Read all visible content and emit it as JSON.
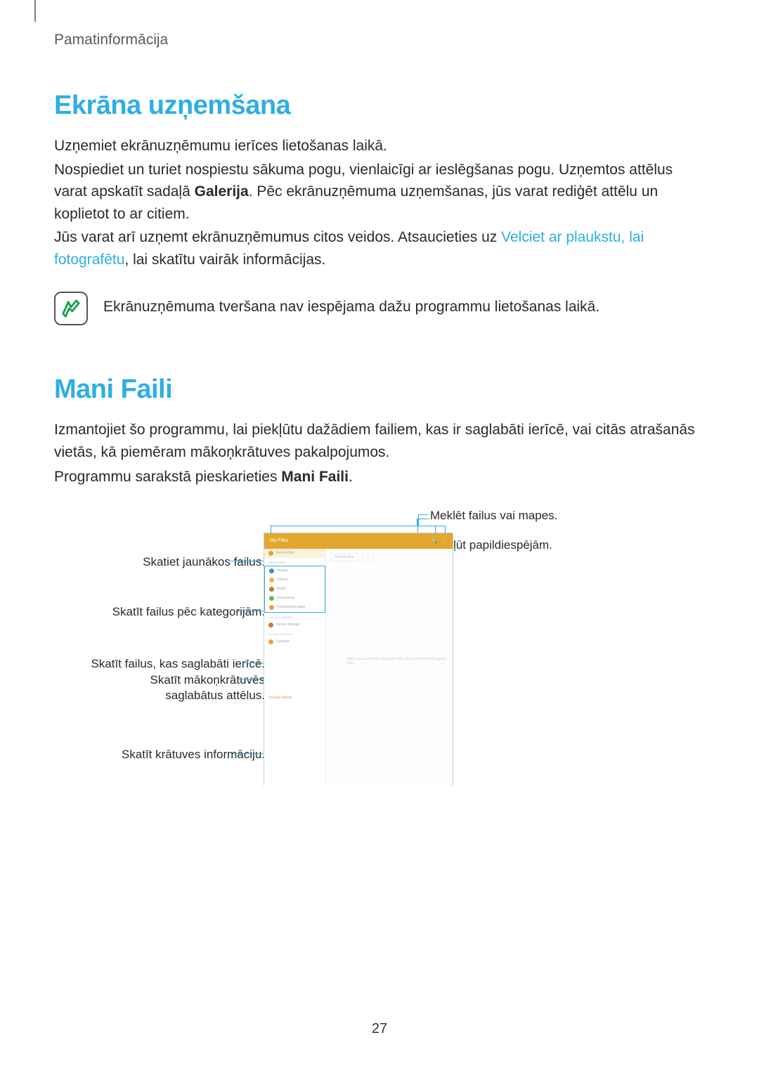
{
  "header": "Pamatinformācija",
  "section1": {
    "title": "Ekrāna uzņemšana",
    "p1": "Uzņemiet ekrānuzņēmumu ierīces lietošanas laikā.",
    "p2a": "Nospiediet un turiet nospiestu sākuma pogu, vienlaicīgi ar ieslēgšanas pogu. Uzņemtos attēlus varat apskatīt sadaļā ",
    "p2b_bold": "Galerija",
    "p2c": ". Pēc ekrānuzņēmuma uzņemšanas, jūs varat rediģēt attēlu un koplietot to ar citiem.",
    "p3a": "Jūs varat arī uzņemt ekrānuzņēmumus citos veidos. Atsaucieties uz ",
    "p3link": "Velciet ar plaukstu, lai fotografētu",
    "p3b": ", lai skatītu vairāk informācijas.",
    "note": "Ekrānuzņēmuma tveršana nav iespējama dažu programmu lietošanas laikā."
  },
  "section2": {
    "title": "Mani Faili",
    "p1": "Izmantojiet šo programmu, lai piekļūtu dažādiem failiem, kas ir saglabāti ierīcē, vai citās atrašanās vietās, kā piemēram mākoņkrātuves pakalpojumos.",
    "p2a": "Programmu sarakstā pieskarieties ",
    "p2b_bold": "Mani Faili",
    "p2c": "."
  },
  "callouts": {
    "c1": "Meklēt failus vai mapes.",
    "c2": "Piekļūt papildiespējām.",
    "c3": "Skatiet jaunākos failus.",
    "c4": "Skatīt failus pēc kategorijām.",
    "c5": "Skatīt failus, kas saglabāti ierīcē.",
    "c6": "Skatīt mākoņkrātuvēs saglabātus attēlus.",
    "c7": "Skatīt krātuves informāciju."
  },
  "device": {
    "app_title": "My Files",
    "search_icon": "search",
    "menu_icon": "menu",
    "recent_label": "Recent files",
    "categories_head": "Categories",
    "cat": [
      "Images",
      "Videos",
      "Audio",
      "Documents",
      "Downloaded apps"
    ],
    "local_head": "Local storage",
    "local_item": "Device storage",
    "cloud_head": "Cloud storage",
    "cloud_item": "Dropbox",
    "storage_details": "Storage details",
    "tab_recent": "Recent files",
    "tab_plus": "+",
    "empty_msg": "After you access files using My Files, the recent files will appear here."
  },
  "page_number": "27"
}
